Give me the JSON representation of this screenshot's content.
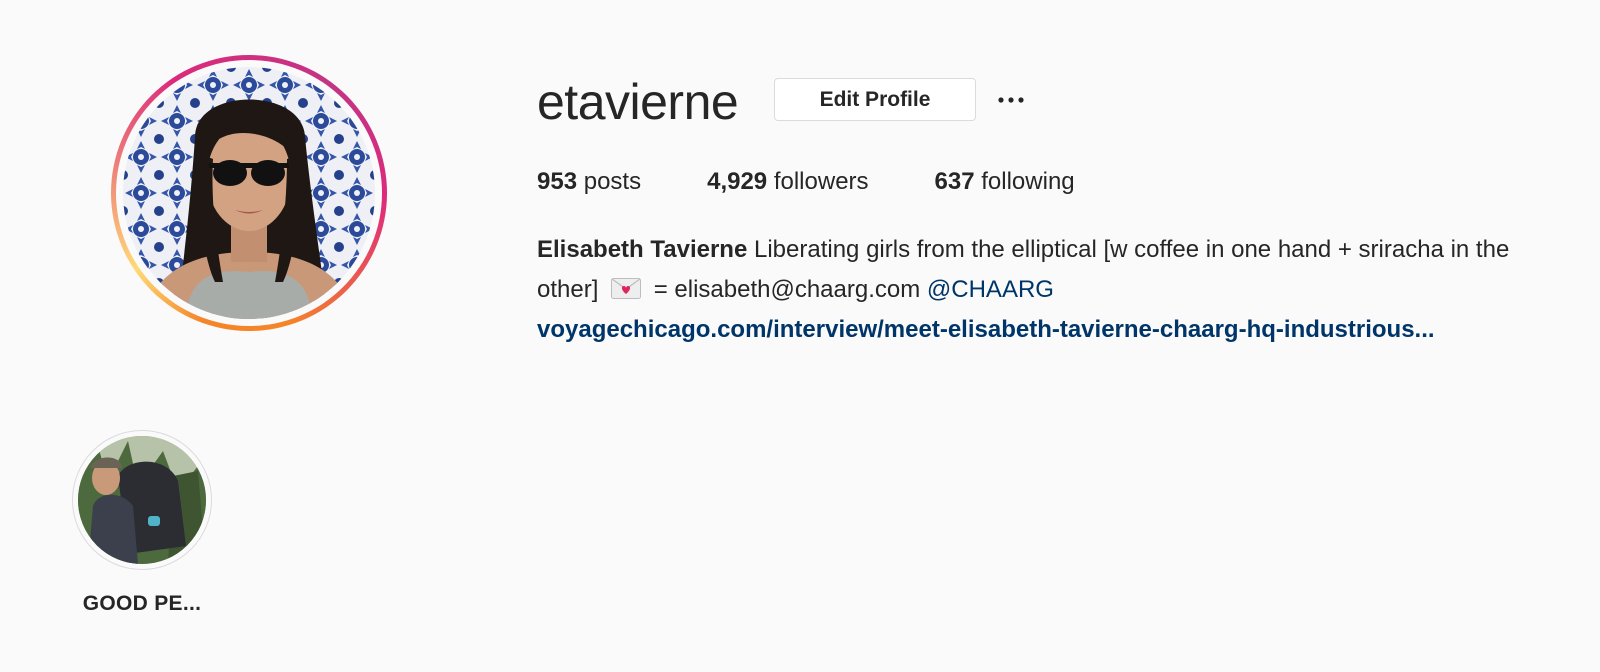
{
  "profile": {
    "username": "etavierne",
    "edit_button": "Edit Profile",
    "more_icon": "more-options-icon"
  },
  "stats": {
    "posts_count": "953",
    "posts_label": "posts",
    "followers_count": "4,929",
    "followers_label": "followers",
    "following_count": "637",
    "following_label": "following"
  },
  "bio": {
    "full_name": "Elisabeth Tavierne",
    "text_line1": "Liberating girls from the elliptical [w coffee in one hand + sriracha in the other]",
    "envelope_icon": "love-letter-icon",
    "text_line2": "= elisabeth@chaarg.com",
    "mention": "@CHAARG",
    "website": "voyagechicago.com/interview/meet-elisabeth-tavierne-chaarg-hq-industrious..."
  },
  "highlights": [
    {
      "label": "GOOD PE..."
    }
  ],
  "colors": {
    "link": "#003569",
    "text": "#262626",
    "background": "#fafafa",
    "border": "#dbdbdb"
  }
}
